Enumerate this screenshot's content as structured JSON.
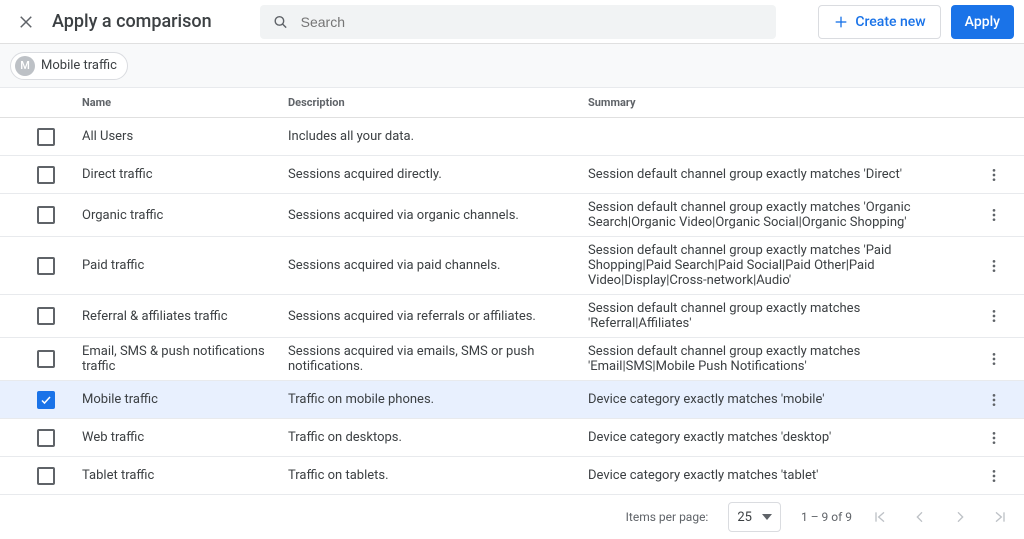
{
  "header": {
    "title": "Apply a comparison",
    "search_placeholder": "Search",
    "create_label": "Create new",
    "apply_label": "Apply"
  },
  "chips": [
    {
      "avatar": "M",
      "label": "Mobile traffic"
    }
  ],
  "columns": {
    "name": "Name",
    "description": "Description",
    "summary": "Summary"
  },
  "rows": [
    {
      "checked": false,
      "name": "All Users",
      "description": "Includes all your data.",
      "summary": "",
      "menu": false
    },
    {
      "checked": false,
      "name": "Direct traffic",
      "description": "Sessions acquired directly.",
      "summary": "Session default channel group exactly matches 'Direct'",
      "menu": true
    },
    {
      "checked": false,
      "name": "Organic traffic",
      "description": "Sessions acquired via organic channels.",
      "summary": "Session default channel group exactly matches 'Organic Search|Organic Video|Organic Social|Organic Shopping'",
      "menu": true
    },
    {
      "checked": false,
      "name": "Paid traffic",
      "description": "Sessions acquired via paid channels.",
      "summary": "Session default channel group exactly matches 'Paid Shopping|Paid Search|Paid Social|Paid Other|Paid Video|Display|Cross-network|Audio'",
      "menu": true
    },
    {
      "checked": false,
      "name": "Referral & affiliates traffic",
      "description": "Sessions acquired via referrals or affiliates.",
      "summary": "Session default channel group exactly matches 'Referral|Affiliates'",
      "menu": true
    },
    {
      "checked": false,
      "name": "Email, SMS & push notifications traffic",
      "description": "Sessions acquired via emails, SMS or push notifications.",
      "summary": "Session default channel group exactly matches 'Email|SMS|Mobile Push Notifications'",
      "menu": true
    },
    {
      "checked": true,
      "name": "Mobile traffic",
      "description": "Traffic on mobile phones.",
      "summary": "Device category exactly matches 'mobile'",
      "menu": true
    },
    {
      "checked": false,
      "name": "Web traffic",
      "description": "Traffic on desktops.",
      "summary": "Device category exactly matches 'desktop'",
      "menu": true
    },
    {
      "checked": false,
      "name": "Tablet traffic",
      "description": "Traffic on tablets.",
      "summary": "Device category exactly matches 'tablet'",
      "menu": true
    }
  ],
  "pagination": {
    "items_per_page_label": "Items per page:",
    "items_per_page_value": "25",
    "range": "1 – 9 of 9"
  }
}
